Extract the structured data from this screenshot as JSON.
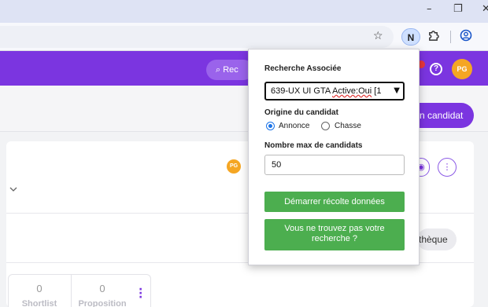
{
  "browser": {
    "window_controls": {
      "minimize": "–",
      "restore": "❐",
      "close": "✕"
    },
    "toolbar_icons": [
      "star-icon",
      "extension-n-icon",
      "puzzle-icon",
      "profile-icon"
    ],
    "extension_badge": "N"
  },
  "app": {
    "brand_color": "#7b35e0",
    "search_label": "Rec",
    "user_initials": "PG",
    "add_candidate_label": "n candidat",
    "library_label": "thèque",
    "stats": [
      {
        "value": "0",
        "label": "Shortlist"
      },
      {
        "value": "0",
        "label": "Proposition"
      }
    ]
  },
  "popup": {
    "search_label": "Recherche Associée",
    "search_value_prefix": "639-UX UI GTA ",
    "search_value_flag": "Active:Oui",
    "search_value_suffix": " [1",
    "origin_label": "Origine du candidat",
    "origin_options": [
      "Annonce",
      "Chasse"
    ],
    "origin_selected": "Annonce",
    "max_label": "Nombre max de candidats",
    "max_value": "50",
    "start_button": "Démarrer récolte données",
    "not_found_button_line1": "Vous ne trouvez pas votre",
    "not_found_button_line2": "recherche ?",
    "button_color": "#4cae4f"
  }
}
